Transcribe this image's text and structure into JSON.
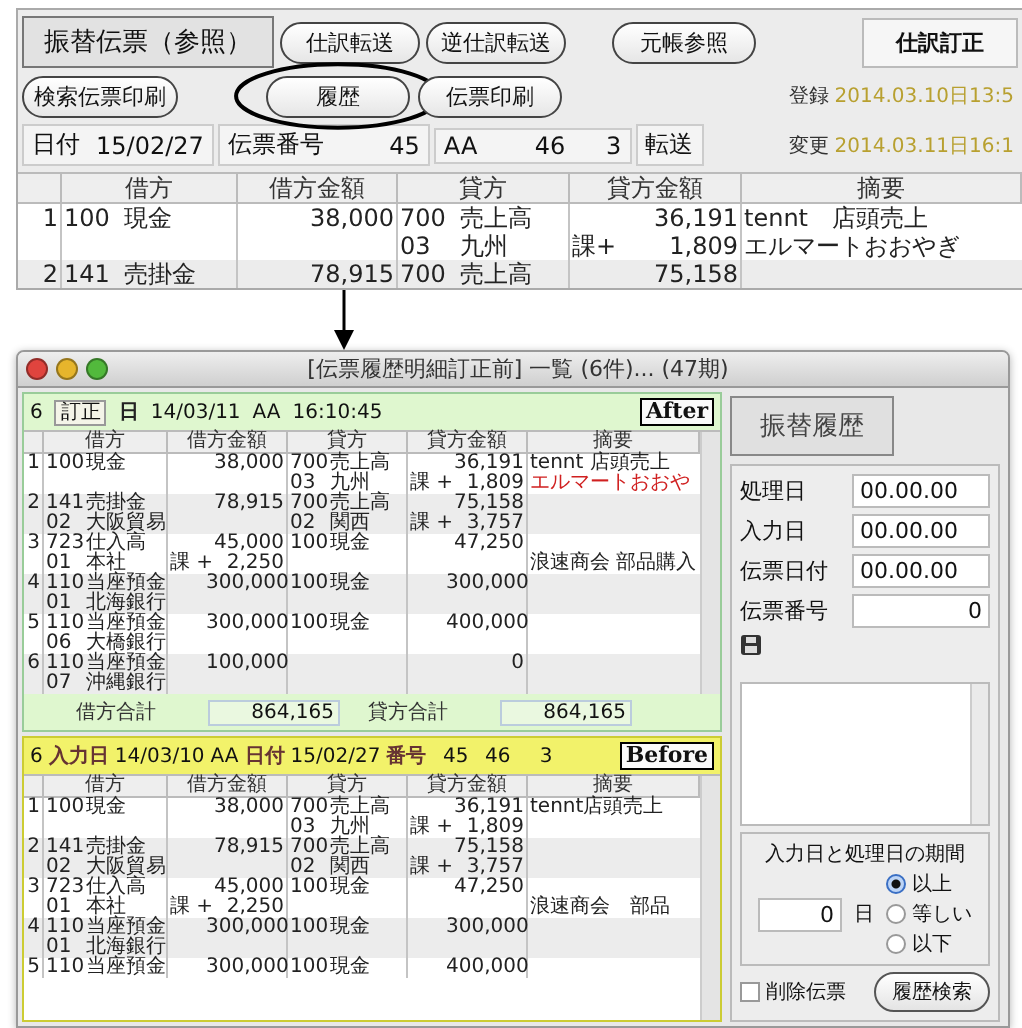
{
  "voucher": {
    "title": "振替伝票（参照）",
    "actions": [
      "仕訳転送",
      "逆仕訳転送",
      "元帳参照"
    ],
    "mode": "仕訳訂正",
    "print_buttons": [
      {
        "label": "検索伝票印刷",
        "circled": false
      },
      {
        "label": "履歴",
        "circled": true
      },
      {
        "label": "伝票印刷",
        "circled": false
      }
    ],
    "stamps": [
      {
        "label": "登録",
        "value": "2014.03.10日13:5"
      },
      {
        "label": "変更",
        "value": "2014.03.11日16:1"
      }
    ],
    "header": {
      "date_label": "日付",
      "date": "15/02/27",
      "number_label": "伝票番号",
      "number": "45",
      "code": "AA",
      "values": [
        "46",
        "3"
      ],
      "status": "転送"
    },
    "table": {
      "columns": [
        "借方",
        "借方金額",
        "貸方",
        "貸方金額",
        "摘要"
      ],
      "rows": [
        {
          "no": "1",
          "lines": [
            {
              "d_code": "100",
              "d_name": "現金",
              "d_amount": "38,000",
              "c_code": "700",
              "c_name": "売上高",
              "c_amount": "36,191",
              "memo": "tennt　店頭売上"
            },
            {
              "c_code": "03",
              "c_name": "九州",
              "c_tax": "課+",
              "c_amount": "1,809",
              "memo": "エルマートおおやぎ"
            }
          ]
        },
        {
          "no": "2",
          "lines": [
            {
              "d_code": "141",
              "d_name": "売掛金",
              "d_amount": "78,915",
              "c_code": "700",
              "c_name": "売上高",
              "c_amount": "75,158"
            }
          ]
        }
      ]
    }
  },
  "history_window": {
    "title": "[伝票履歴明細訂正前] 一覧 (6件)... (47期)",
    "records": [
      {
        "kind": "after",
        "number": "6",
        "items": [
          {
            "kind": "badge",
            "text": "訂正"
          },
          {
            "kind": "label",
            "text": "日"
          },
          {
            "kind": "value",
            "text": "14/03/11"
          },
          {
            "kind": "value",
            "text": "AA"
          },
          {
            "kind": "value",
            "text": "16:10:45"
          }
        ],
        "tag": "After",
        "table": {
          "columns": [
            "借方",
            "借方金額",
            "貸方",
            "貸方金額",
            "摘要"
          ],
          "rows": [
            {
              "no": "1",
              "lines": [
                {
                  "d_code": "100",
                  "d_name": "現金",
                  "d_amount": "38,000",
                  "c_code": "700",
                  "c_name": "売上高",
                  "c_amount": "36,191",
                  "memo": "tennt 店頭売上"
                },
                {
                  "c_code": "03",
                  "c_name": "九州",
                  "c_tax": "課 +",
                  "c_amount": "1,809",
                  "memo": "エルマートおおや",
                  "color": "#d02020"
                }
              ]
            },
            {
              "no": "2",
              "lines": [
                {
                  "d_code": "141",
                  "d_name": "売掛金",
                  "d_amount": "78,915",
                  "c_code": "700",
                  "c_name": "売上高",
                  "c_amount": "75,158"
                },
                {
                  "d_code": "02",
                  "d_name": "大阪貿易",
                  "c_code": "02",
                  "c_name": "関西",
                  "c_tax": "課 +",
                  "c_amount": "3,757"
                }
              ]
            },
            {
              "no": "3",
              "lines": [
                {
                  "d_code": "723",
                  "d_name": "仕入高",
                  "d_amount": "45,000",
                  "c_code": "100",
                  "c_name": "現金",
                  "c_amount": "47,250"
                },
                {
                  "d_code": "01",
                  "d_name": "本社",
                  "d_tax": "課 +",
                  "d_amount": "2,250",
                  "memo": "浪速商会 部品購入"
                }
              ]
            },
            {
              "no": "4",
              "lines": [
                {
                  "d_code": "110",
                  "d_name": "当座預金",
                  "d_amount": "300,000",
                  "c_code": "100",
                  "c_name": "現金",
                  "c_amount": "300,000"
                },
                {
                  "d_code": "01",
                  "d_name": "北海銀行"
                }
              ]
            },
            {
              "no": "5",
              "lines": [
                {
                  "d_code": "110",
                  "d_name": "当座預金",
                  "d_amount": "300,000",
                  "c_code": "100",
                  "c_name": "現金",
                  "c_amount": "400,000"
                },
                {
                  "d_code": "06",
                  "d_name": "大橋銀行"
                }
              ]
            },
            {
              "no": "6",
              "lines": [
                {
                  "d_code": "110",
                  "d_name": "当座預金",
                  "d_amount": "100,000",
                  "c_amount": "0"
                },
                {
                  "d_code": "07",
                  "d_name": "沖縄銀行"
                }
              ]
            }
          ]
        },
        "totals": {
          "debit_label": "借方合計",
          "debit": "864,165",
          "credit_label": "貸方合計",
          "credit": "864,165"
        }
      },
      {
        "kind": "before",
        "number": "6",
        "items": [
          {
            "kind": "label",
            "text": "入力日"
          },
          {
            "kind": "value",
            "text": "14/03/10"
          },
          {
            "kind": "value",
            "text": "AA"
          },
          {
            "kind": "label",
            "text": "日付"
          },
          {
            "kind": "value",
            "text": "15/02/27"
          },
          {
            "kind": "label",
            "text": "番号"
          },
          {
            "kind": "number",
            "text": "45"
          },
          {
            "kind": "number",
            "text": "46"
          },
          {
            "kind": "number",
            "text": "3"
          }
        ],
        "tag": "Before",
        "table": {
          "columns": [
            "借方",
            "借方金額",
            "貸方",
            "貸方金額",
            "摘要"
          ],
          "rows": [
            {
              "no": "1",
              "lines": [
                {
                  "d_code": "100",
                  "d_name": "現金",
                  "d_amount": "38,000",
                  "c_code": "700",
                  "c_name": "売上高",
                  "c_amount": "36,191",
                  "memo": "tennt店頭売上"
                },
                {
                  "c_code": "03",
                  "c_name": "九州",
                  "c_tax": "課 +",
                  "c_amount": "1,809"
                }
              ]
            },
            {
              "no": "2",
              "lines": [
                {
                  "d_code": "141",
                  "d_name": "売掛金",
                  "d_amount": "78,915",
                  "c_code": "700",
                  "c_name": "売上高",
                  "c_amount": "75,158"
                },
                {
                  "d_code": "02",
                  "d_name": "大阪貿易",
                  "c_code": "02",
                  "c_name": "関西",
                  "c_tax": "課 +",
                  "c_amount": "3,757"
                }
              ]
            },
            {
              "no": "3",
              "lines": [
                {
                  "d_code": "723",
                  "d_name": "仕入高",
                  "d_amount": "45,000",
                  "c_code": "100",
                  "c_name": "現金",
                  "c_amount": "47,250"
                },
                {
                  "d_code": "01",
                  "d_name": "本社",
                  "d_tax": "課 +",
                  "d_amount": "2,250",
                  "memo": "浪速商会　部品"
                }
              ]
            },
            {
              "no": "4",
              "lines": [
                {
                  "d_code": "110",
                  "d_name": "当座預金",
                  "d_amount": "300,000",
                  "c_code": "100",
                  "c_name": "現金",
                  "c_amount": "300,000"
                },
                {
                  "d_code": "01",
                  "d_name": "北海銀行"
                }
              ]
            },
            {
              "no": "5",
              "lines": [
                {
                  "d_code": "110",
                  "d_name": "当座預金",
                  "d_amount": "300,000",
                  "c_code": "100",
                  "c_name": "現金",
                  "c_amount": "400,000"
                }
              ]
            }
          ]
        }
      }
    ],
    "side": {
      "tab": "振替履歴",
      "fields": [
        {
          "label": "処理日",
          "value": "00.00.00",
          "kind": "date"
        },
        {
          "label": "入力日",
          "value": "00.00.00",
          "kind": "date"
        },
        {
          "label": "伝票日付",
          "value": "00.00.00",
          "kind": "date"
        },
        {
          "label": "伝票番号",
          "value": "0",
          "kind": "number"
        }
      ],
      "period": {
        "title": "入力日と処理日の期間",
        "days": "0",
        "unit": "日",
        "options": [
          {
            "label": "以上",
            "selected": true
          },
          {
            "label": "等しい",
            "selected": false
          },
          {
            "label": "以下",
            "selected": false
          }
        ]
      },
      "deleted": {
        "label": "削除伝票",
        "checked": false
      },
      "search_button": "履歴検索"
    }
  }
}
